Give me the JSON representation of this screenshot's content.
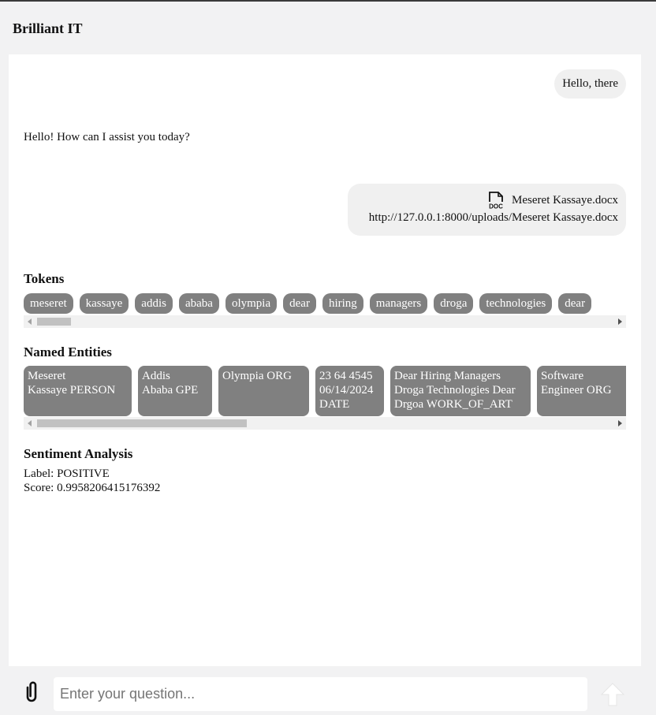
{
  "app": {
    "title": "Brilliant IT"
  },
  "chat": {
    "user_message": "Hello, there",
    "bot_message": "Hello! How can I assist you today?",
    "file_name": "Meseret Kassaye.docx",
    "file_url": "http://127.0.0.1:8000/uploads/Meseret Kassaye.docx",
    "file_icon": "doc-file-icon"
  },
  "tokens": {
    "title": "Tokens",
    "items": [
      "meseret",
      "kassaye",
      "addis",
      "ababa",
      "olympia",
      "dear",
      "hiring",
      "managers",
      "droga",
      "technologies",
      "dear"
    ]
  },
  "entities": {
    "title": "Named Entities",
    "items": [
      " Meseret\nKassaye  PERSON",
      " Addis\nAbaba  GPE",
      " Olympia  ORG",
      " 23 64 4545\n06/14/2024\n DATE",
      " Dear Hiring Managers\nDroga Technologies Dear\nDrgoa  WORK_OF_ART",
      " Software\nEngineer  ORG"
    ]
  },
  "sentiment": {
    "title": "Sentiment Analysis",
    "label_line": "Label: POSITIVE",
    "score_line": "Score: 0.9958206415176392"
  },
  "composer": {
    "placeholder": "Enter your question...",
    "attach_icon": "paperclip-icon",
    "send_icon": "arrow-up-icon"
  }
}
